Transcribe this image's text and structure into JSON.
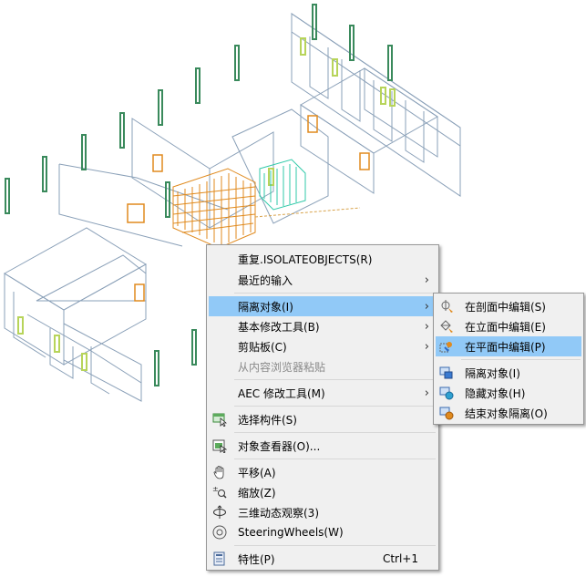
{
  "context_menu": {
    "items": [
      {
        "label": "重复.ISOLATEOBJECTS(R)"
      },
      {
        "label": "最近的输入"
      },
      {
        "label": "隔离对象(I)"
      },
      {
        "label": "基本修改工具(B)"
      },
      {
        "label": "剪贴板(C)"
      },
      {
        "label": "从内容浏览器粘贴"
      },
      {
        "label": "AEC 修改工具(M)"
      },
      {
        "label": "选择构件(S)"
      },
      {
        "label": "对象查看器(O)..."
      },
      {
        "label": "平移(A)"
      },
      {
        "label": "缩放(Z)"
      },
      {
        "label": "三维动态观察(3)"
      },
      {
        "label": "SteeringWheels(W)"
      },
      {
        "label": "特性(P)",
        "shortcut": "Ctrl+1"
      }
    ],
    "submenu_arrow": "›"
  },
  "submenu": {
    "items": [
      {
        "label": "在剖面中编辑(S)"
      },
      {
        "label": "在立面中编辑(E)"
      },
      {
        "label": "在平面中编辑(P)"
      },
      {
        "label": "隔离对象(I)"
      },
      {
        "label": "隐藏对象(H)"
      },
      {
        "label": "结束对象隔离(O)"
      }
    ]
  },
  "colors": {
    "highlight": "#91c9f7",
    "menu_bg": "#f0f0f0",
    "wall_stroke": "#8aa0b8",
    "door_orange": "#e08a1e",
    "column_green": "#3a8a5c",
    "window_lime": "#b7d45a",
    "isolated_cyan": "#2fc9a8"
  }
}
